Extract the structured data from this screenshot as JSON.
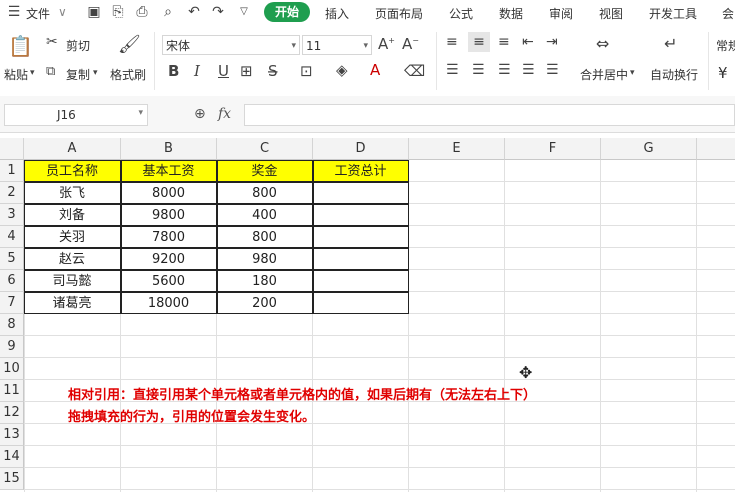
{
  "menubar": {
    "file": "文件",
    "tabs": [
      "开始",
      "插入",
      "页面布局",
      "公式",
      "数据",
      "审阅",
      "视图",
      "开发工具",
      "会"
    ]
  },
  "ribbon": {
    "paste": "粘贴",
    "cut": "剪切",
    "copy": "复制",
    "format_painter": "格式刷",
    "font_name": "宋体",
    "font_size": "11",
    "merge_center": "合并居中",
    "wrap_text": "自动换行",
    "number_format": "常规",
    "currency": "¥"
  },
  "formula_bar": {
    "name_box": "J16",
    "fx": "fx",
    "content": ""
  },
  "columns": [
    "A",
    "B",
    "C",
    "D",
    "E",
    "F",
    "G"
  ],
  "rows": [
    "1",
    "2",
    "3",
    "4",
    "5",
    "6",
    "7",
    "8",
    "9",
    "10",
    "11",
    "12",
    "13",
    "14",
    "15"
  ],
  "table": {
    "headers": [
      "员工名称",
      "基本工资",
      "奖金",
      "工资总计"
    ],
    "rows": [
      [
        "张飞",
        "8000",
        "800",
        ""
      ],
      [
        "刘备",
        "9800",
        "400",
        ""
      ],
      [
        "关羽",
        "7800",
        "800",
        ""
      ],
      [
        "赵云",
        "9200",
        "980",
        ""
      ],
      [
        "司马懿",
        "5600",
        "180",
        ""
      ],
      [
        "诸葛亮",
        "18000",
        "200",
        ""
      ]
    ]
  },
  "note": {
    "line1": "相对引用：直接引用某个单元格或者单元格内的值，如果后期有（无法左右上下）",
    "line2": "拖拽填充的行为，引用的位置会发生变化。"
  },
  "colors": {
    "active_tab": "#1f9e4f",
    "header_fill": "#ffff00",
    "note_text": "#e00000"
  }
}
